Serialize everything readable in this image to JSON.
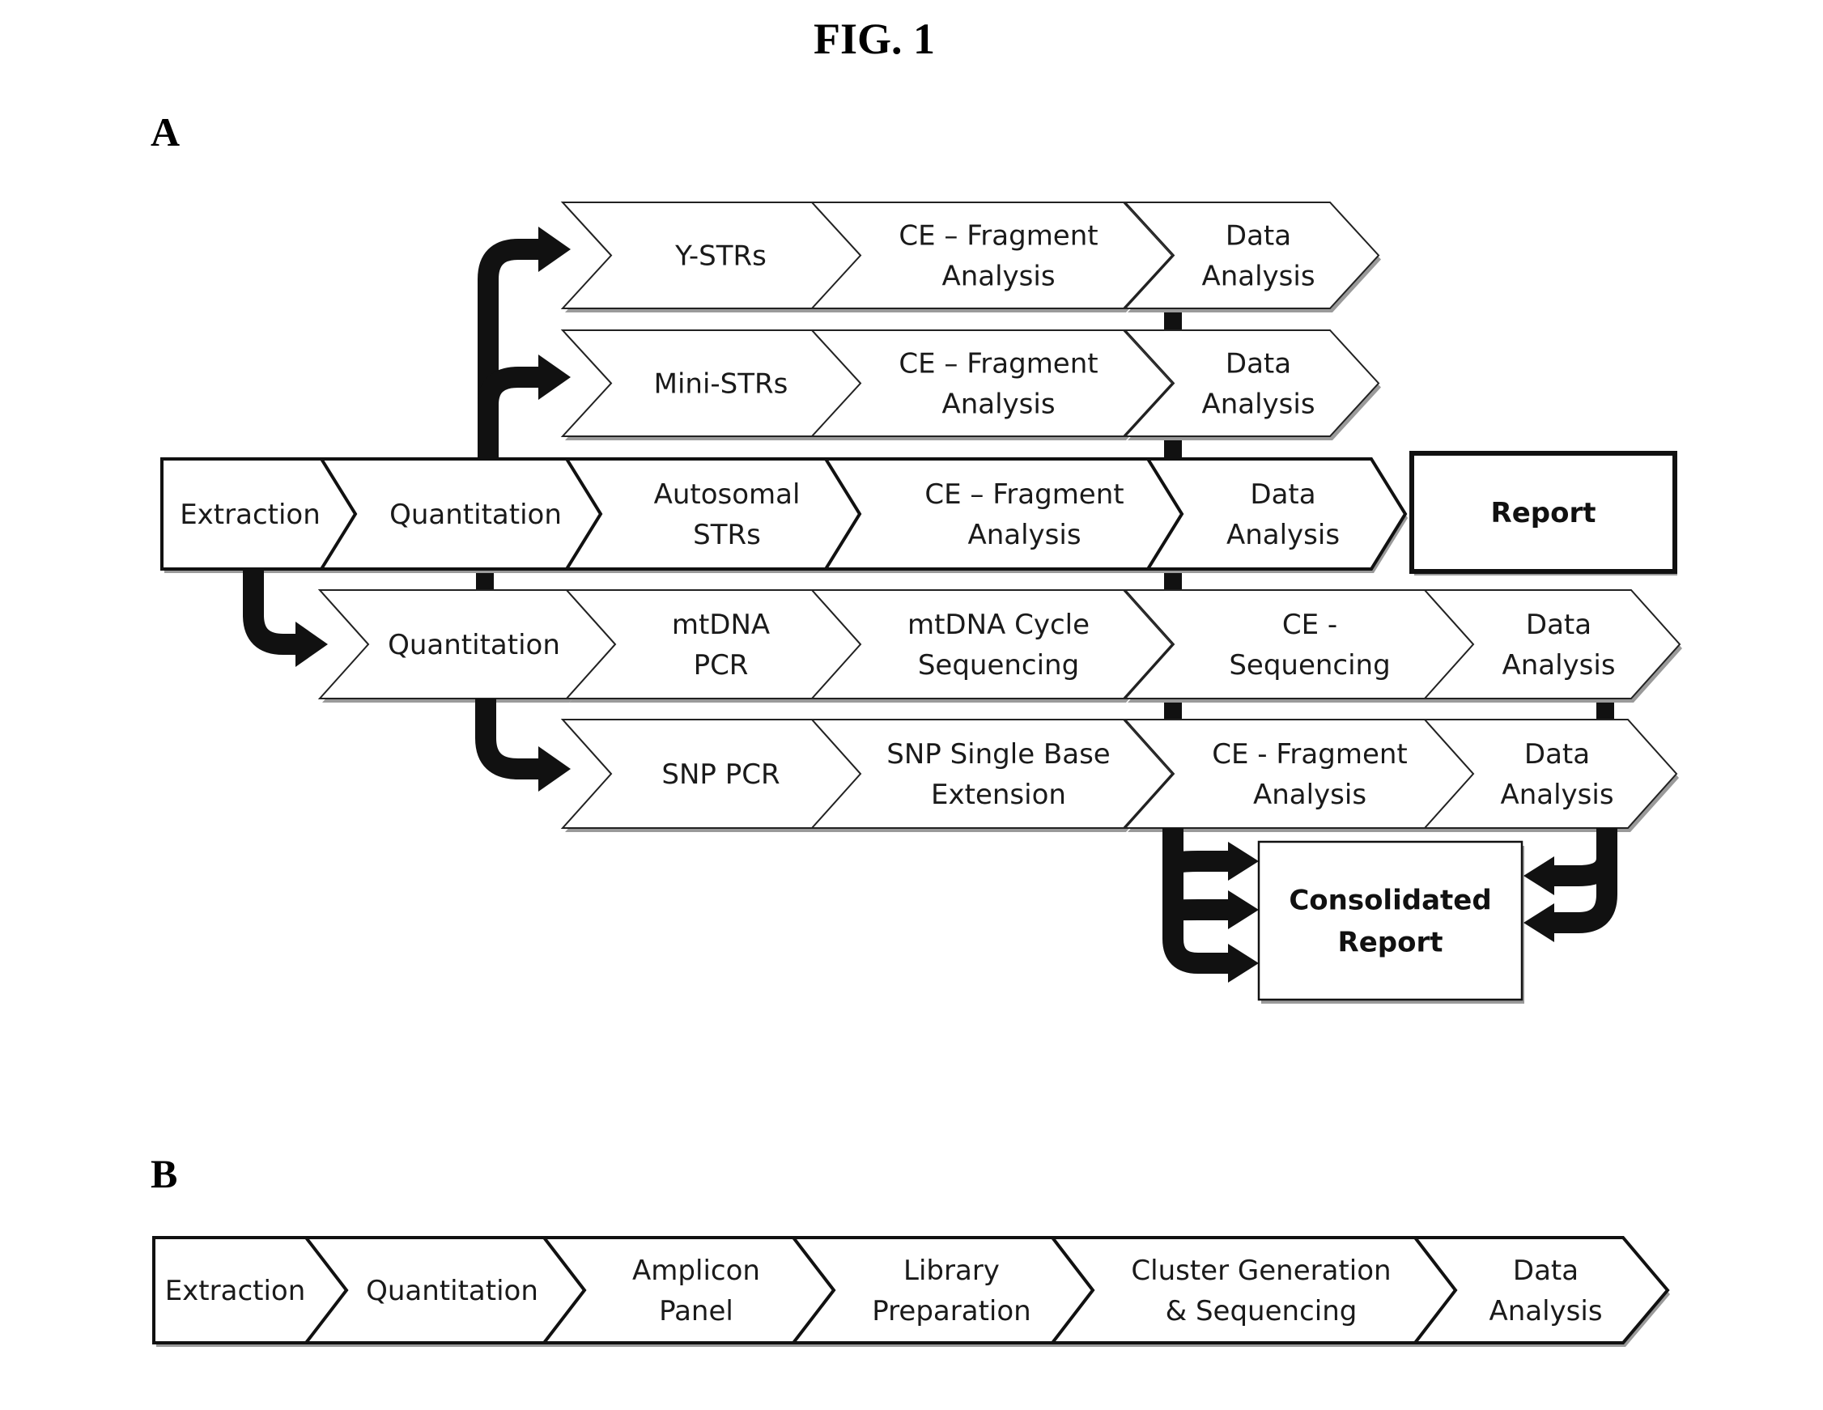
{
  "figure": {
    "title": "FIG. 1",
    "panel_a_label": "A",
    "panel_b_label": "B"
  },
  "panel_a": {
    "rows": [
      {
        "id": "y-strs",
        "steps": [
          [
            "Y-STRs"
          ],
          [
            "CE –  Fragment",
            "Analysis"
          ],
          [
            "Data",
            "Analysis"
          ]
        ]
      },
      {
        "id": "mini-strs",
        "steps": [
          [
            "Mini-STRs"
          ],
          [
            "CE –  Fragment",
            "Analysis"
          ],
          [
            "Data",
            "Analysis"
          ]
        ]
      },
      {
        "id": "main",
        "steps": [
          [
            "Extraction"
          ],
          [
            "Quantitation"
          ],
          [
            "Autosomal",
            "STRs"
          ],
          [
            "CE – Fragment",
            "Analysis"
          ],
          [
            "Data",
            "Analysis"
          ]
        ],
        "end_box": [
          "Report"
        ]
      },
      {
        "id": "mtdna",
        "steps": [
          [
            "Quantitation"
          ],
          [
            "mtDNA",
            "PCR"
          ],
          [
            "mtDNA Cycle",
            "Sequencing"
          ],
          [
            "CE -",
            "Sequencing"
          ],
          [
            "Data",
            "Analysis"
          ]
        ]
      },
      {
        "id": "snp",
        "steps": [
          [
            "SNP PCR"
          ],
          [
            "SNP Single Base",
            "Extension"
          ],
          [
            "CE - Fragment",
            "Analysis"
          ],
          [
            "Data",
            "Analysis"
          ]
        ]
      }
    ],
    "consolidated_report": [
      "Consolidated",
      "Report"
    ]
  },
  "panel_b": {
    "steps": [
      [
        "Extraction"
      ],
      [
        "Quantitation"
      ],
      [
        "Amplicon",
        "Panel"
      ],
      [
        "Library",
        "Preparation"
      ],
      [
        "Cluster Generation",
        "& Sequencing"
      ],
      [
        "Data",
        "Analysis"
      ]
    ]
  }
}
